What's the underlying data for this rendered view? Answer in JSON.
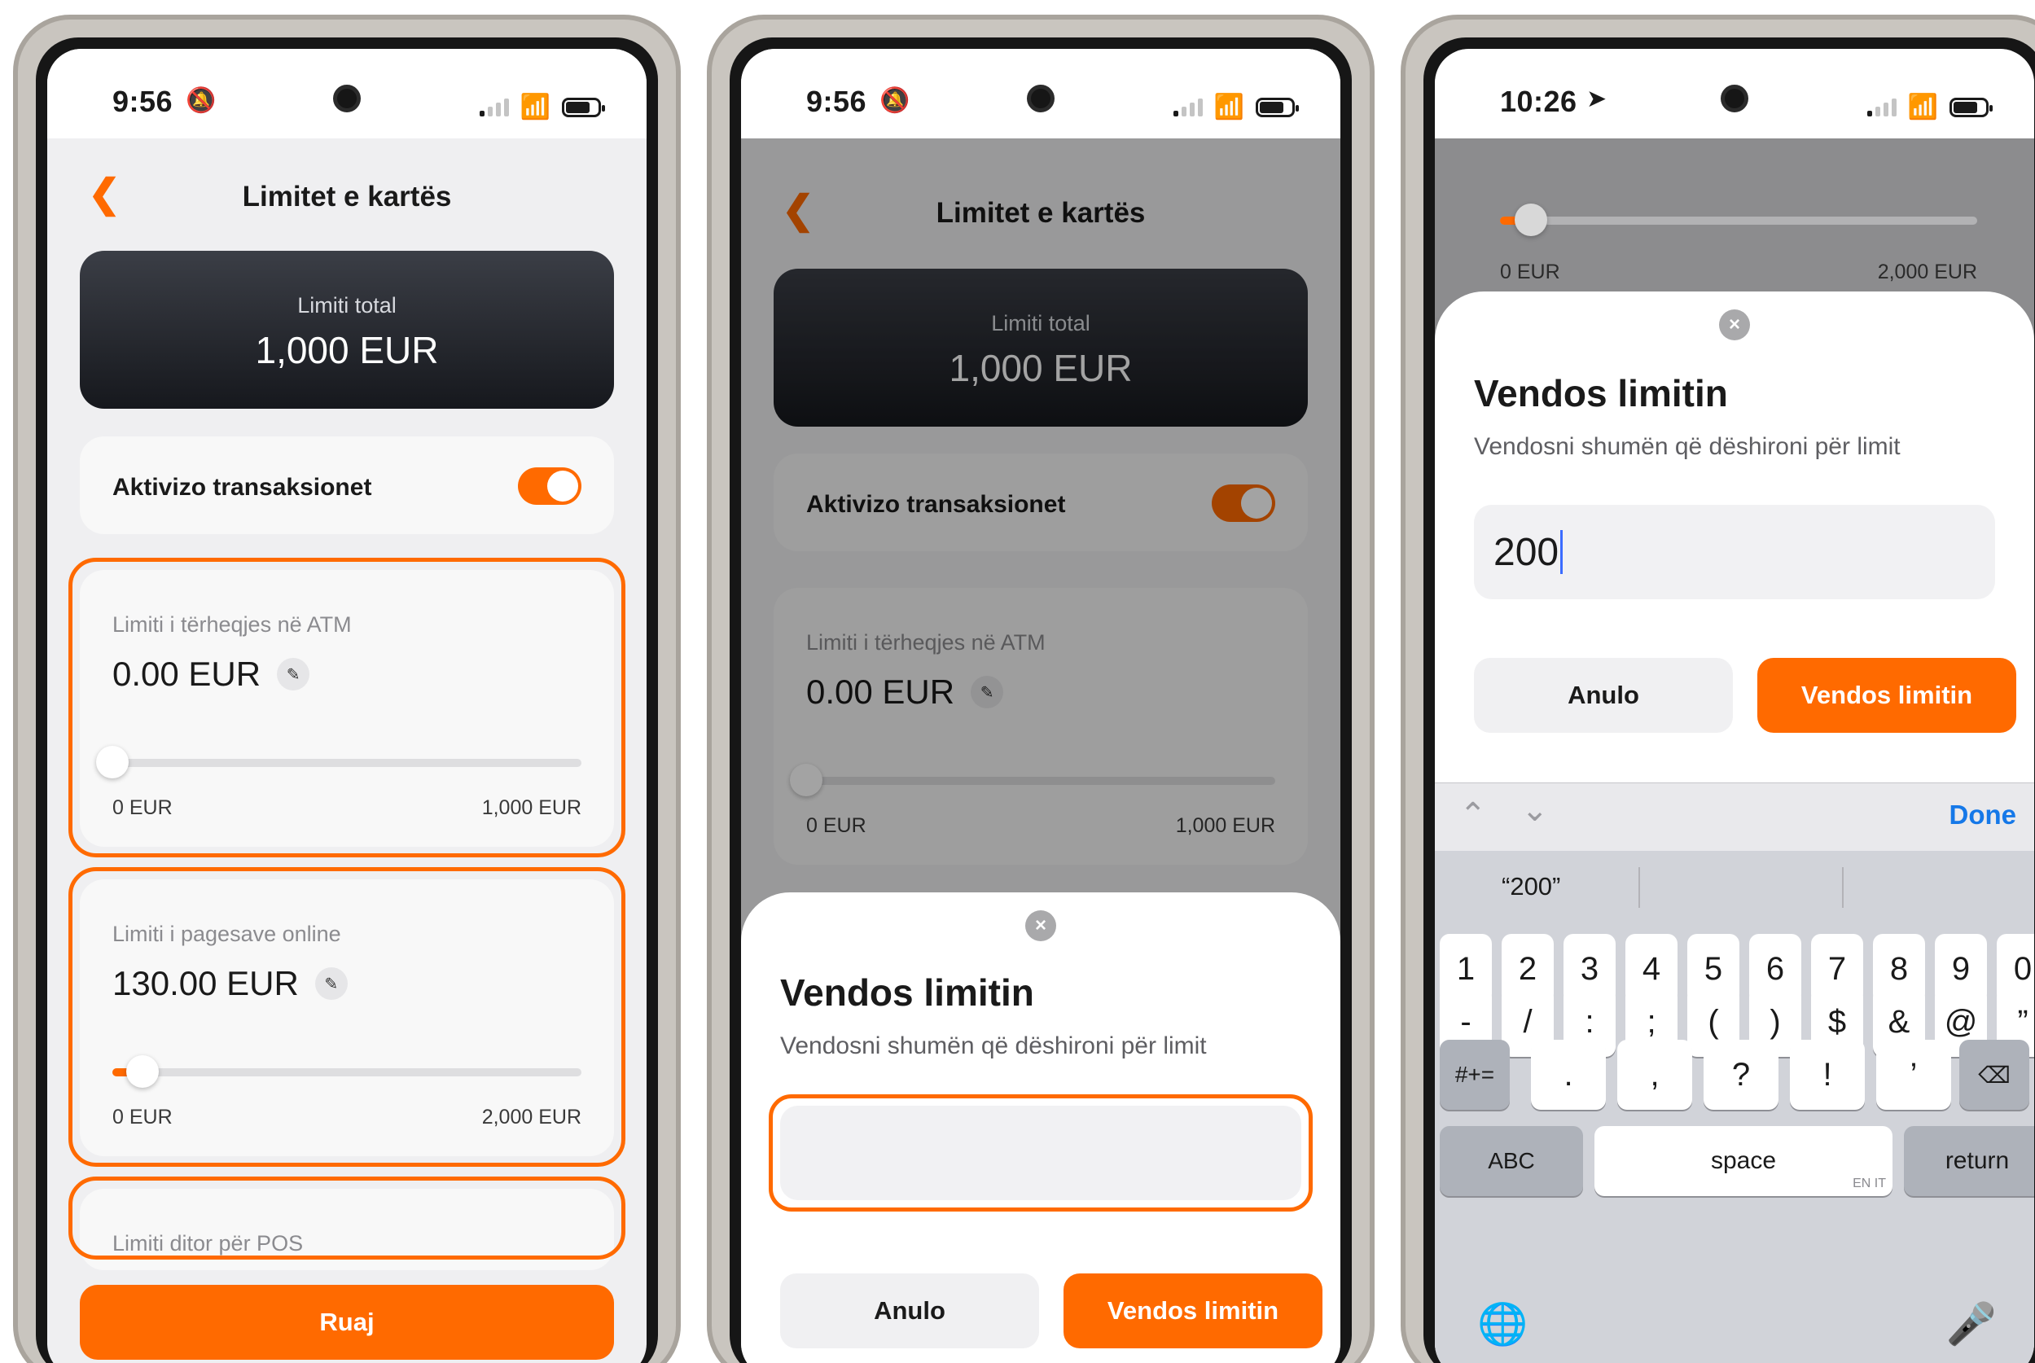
{
  "status": {
    "time_1": "9:56",
    "time_2": "9:56",
    "time_3": "10:26"
  },
  "screen1": {
    "title": "Limitet e kartës",
    "back_icon": "chevron-left-icon",
    "total_label": "Limiti total",
    "total_value": "1,000 EUR",
    "toggle_label": "Aktivizo transaksionet",
    "toggle_on": true,
    "atm": {
      "label": "Limiti i tërheqjes në ATM",
      "value": "0.00 EUR",
      "min": "0 EUR",
      "max": "1,000 EUR",
      "fraction": 0.0
    },
    "online": {
      "label": "Limiti i pagesave online",
      "value": "130.00 EUR",
      "min": "0 EUR",
      "max": "2,000 EUR",
      "fraction": 0.065
    },
    "pos": {
      "label": "Limiti ditor për POS"
    },
    "save_label": "Ruaj"
  },
  "screen2": {
    "title": "Limitet e kartës",
    "total_label": "Limiti total",
    "total_value": "1,000 EUR",
    "toggle_label": "Aktivizo transaksionet",
    "atm": {
      "label": "Limiti i tërheqjes në ATM",
      "value": "0.00 EUR",
      "min": "0 EUR",
      "max": "1,000 EUR",
      "fraction": 0.0
    },
    "sheet": {
      "title": "Vendos limitin",
      "subtitle": "Vendosni shumën që dëshironi për limit",
      "input_value": "",
      "cancel_label": "Anulo",
      "confirm_label": "Vendos limitin"
    }
  },
  "screen3": {
    "bg_min": "0 EUR",
    "bg_max": "2,000 EUR",
    "bg_fraction": 0.065,
    "sheet": {
      "title": "Vendos limitin",
      "subtitle": "Vendosni shumën që dëshironi për limit",
      "input_value": "200",
      "cancel_label": "Anulo",
      "confirm_label": "Vendos limitin"
    },
    "keyboard": {
      "done_label": "Done",
      "suggestion": "“200”",
      "row1": [
        "1",
        "2",
        "3",
        "4",
        "5",
        "6",
        "7",
        "8",
        "9",
        "0"
      ],
      "row2": [
        "-",
        "/",
        ":",
        ";",
        "(",
        ")",
        "$",
        "&",
        "@",
        "”"
      ],
      "row3": [
        ".",
        ",",
        "?",
        "!",
        "’"
      ],
      "symbols_key": "#+=",
      "abc_key": "ABC",
      "space_key": "space",
      "space_hint": "EN IT",
      "return_key": "return"
    }
  },
  "colors": {
    "accent": "#ff6a00",
    "dark_card": "#1c1e23",
    "link_blue": "#1578e8"
  }
}
